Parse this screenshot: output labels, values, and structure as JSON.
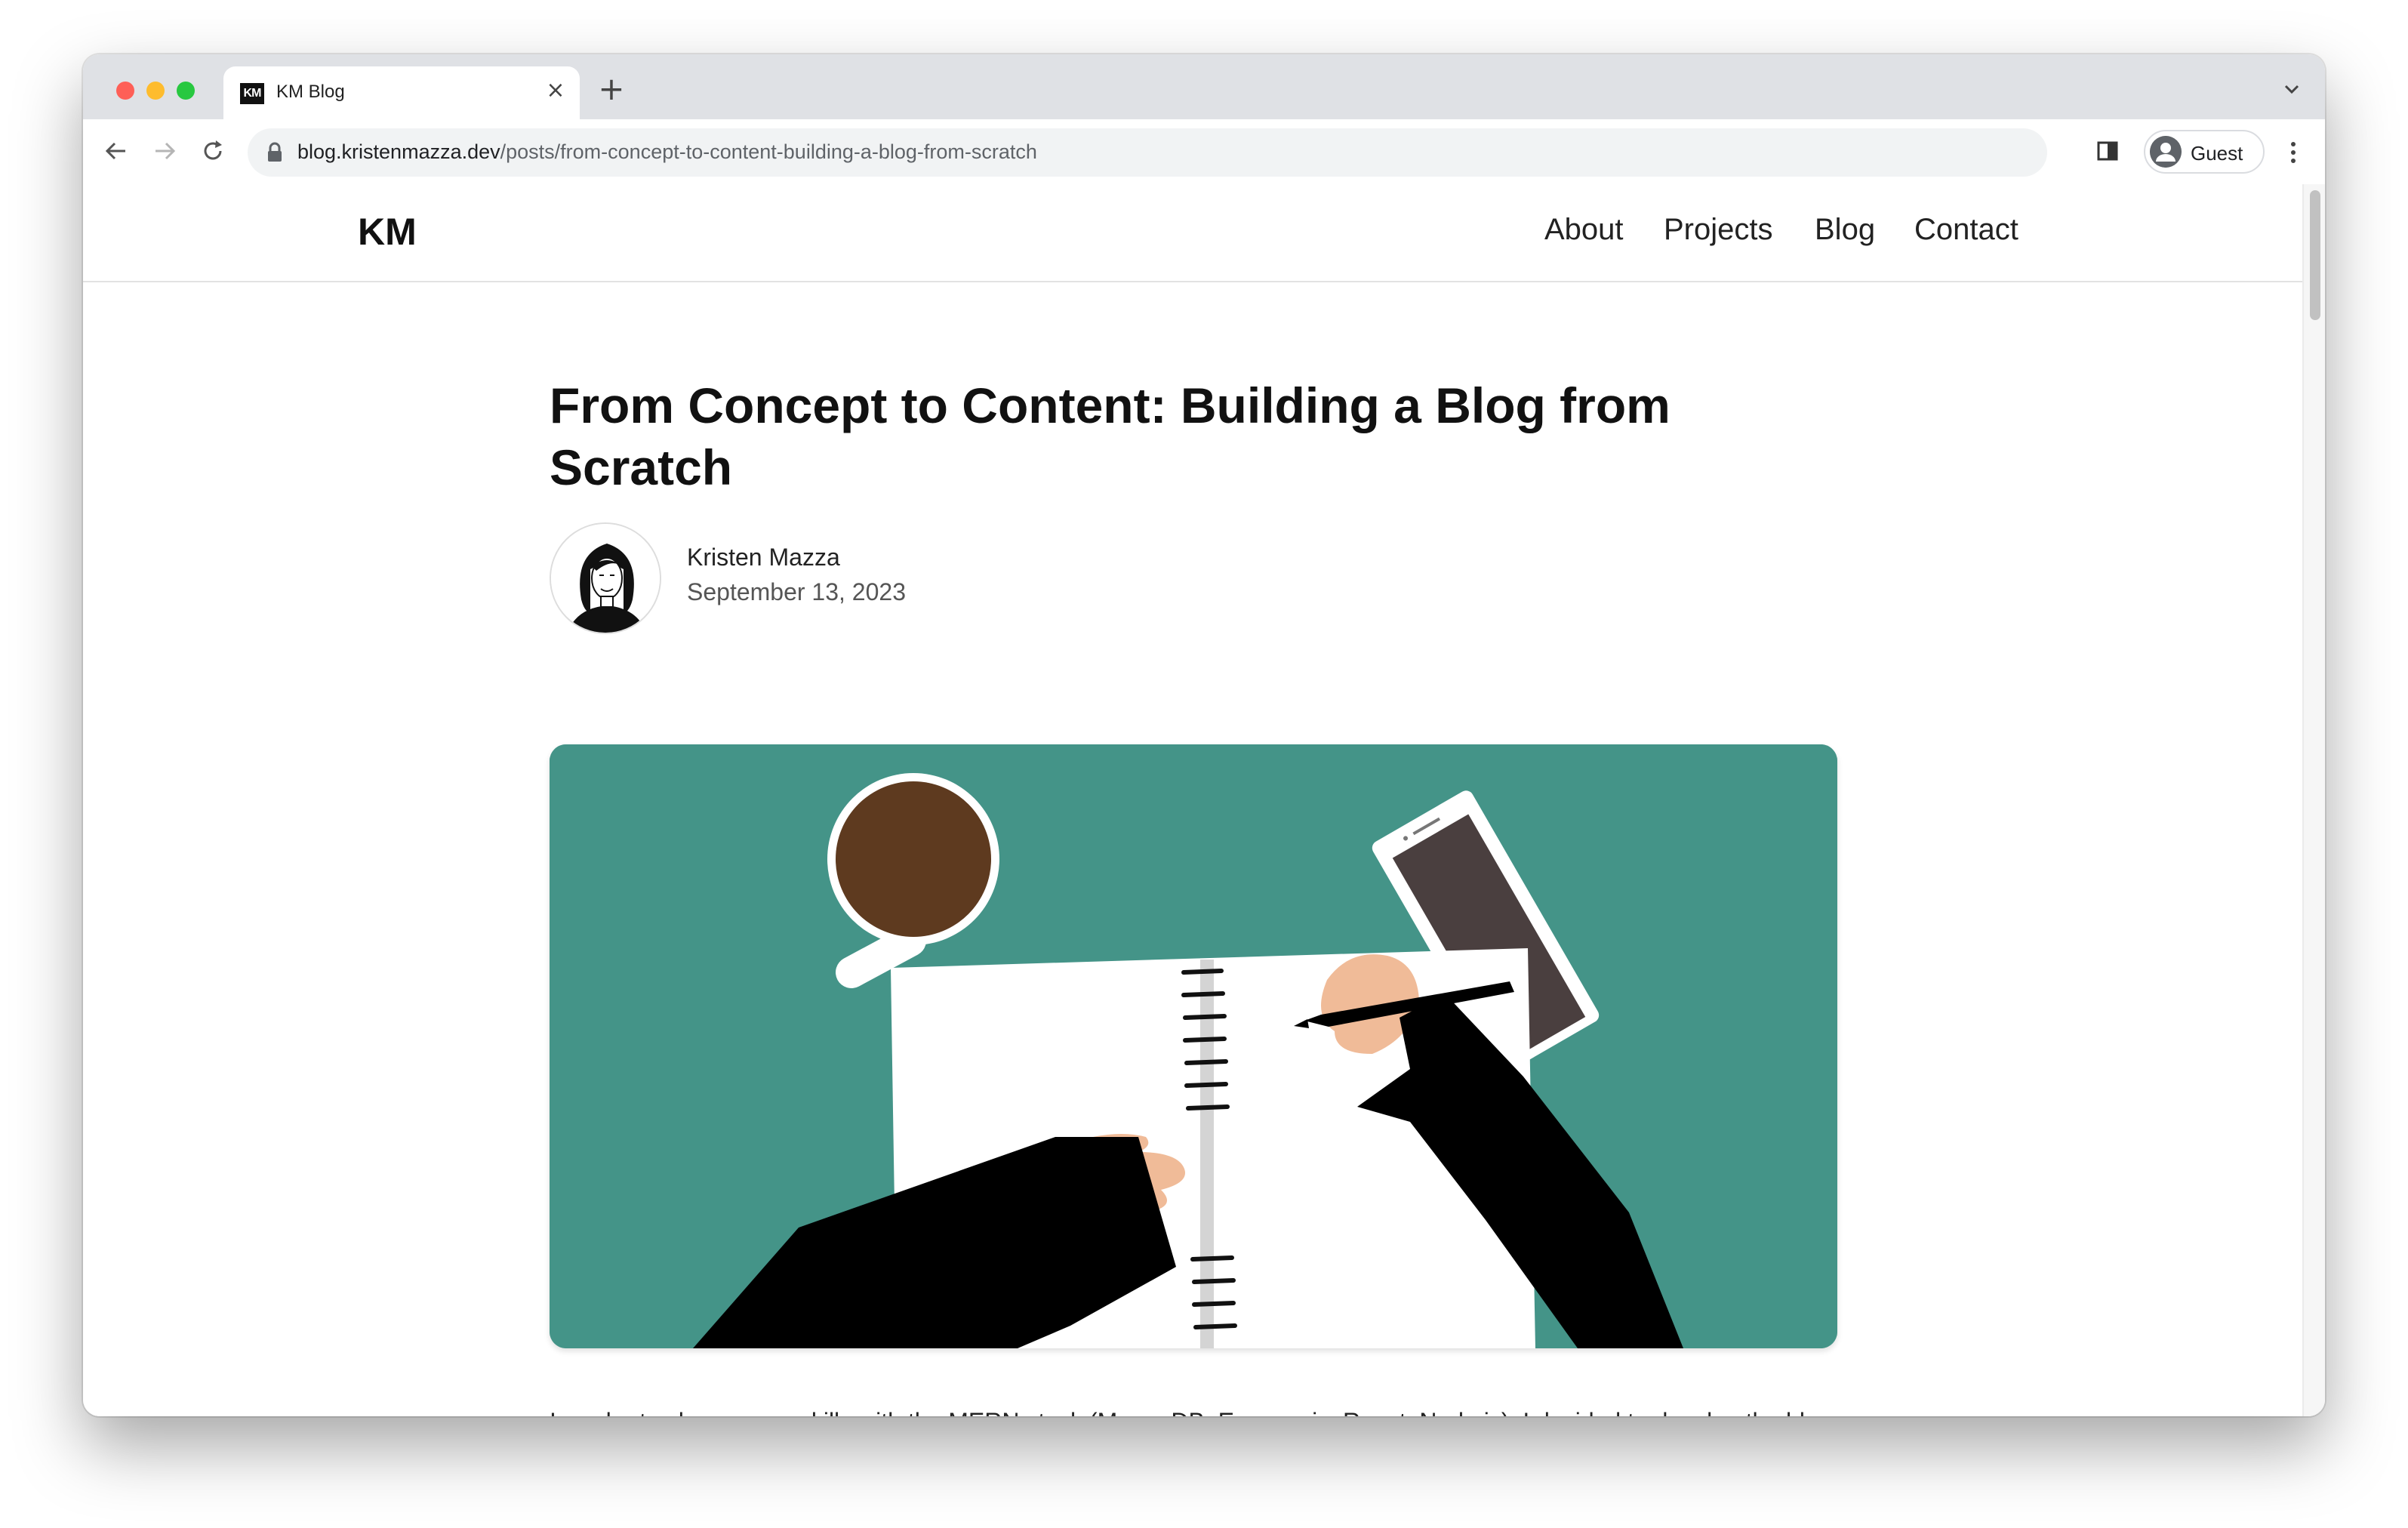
{
  "browser": {
    "tab": {
      "favicon_text": "KM",
      "title": "KM Blog"
    },
    "url": {
      "host": "blog.kristenmazza.dev",
      "path": "/posts/from-concept-to-content-building-a-blog-from-scratch"
    },
    "profile_label": "Guest",
    "icons": [
      "close-icon",
      "plus-icon",
      "chevron-down-icon",
      "back-arrow-icon",
      "forward-arrow-icon",
      "reload-icon",
      "lock-icon",
      "side-panel-icon",
      "profile-icon",
      "kebab-menu-icon"
    ]
  },
  "site": {
    "logo": "KM",
    "nav": [
      "About",
      "Projects",
      "Blog",
      "Contact"
    ]
  },
  "post": {
    "title": "From Concept to Content: Building a Blog from Scratch",
    "author": "Kristen Mazza",
    "date": "September 13, 2023",
    "hero_colors": {
      "background": "#449488",
      "coffee": "#5e3a1f",
      "phone": "#4a3f3f",
      "skin": "#f0bb98",
      "sleeve": "#000000"
    },
    "intro": "In order to sharpen my skills with the MERN stack (MongoDB, Express.js, React, Node.js), I decided to develop the blog that you're currently reading. In this post, I will walk you through my approach and experiences while"
  }
}
